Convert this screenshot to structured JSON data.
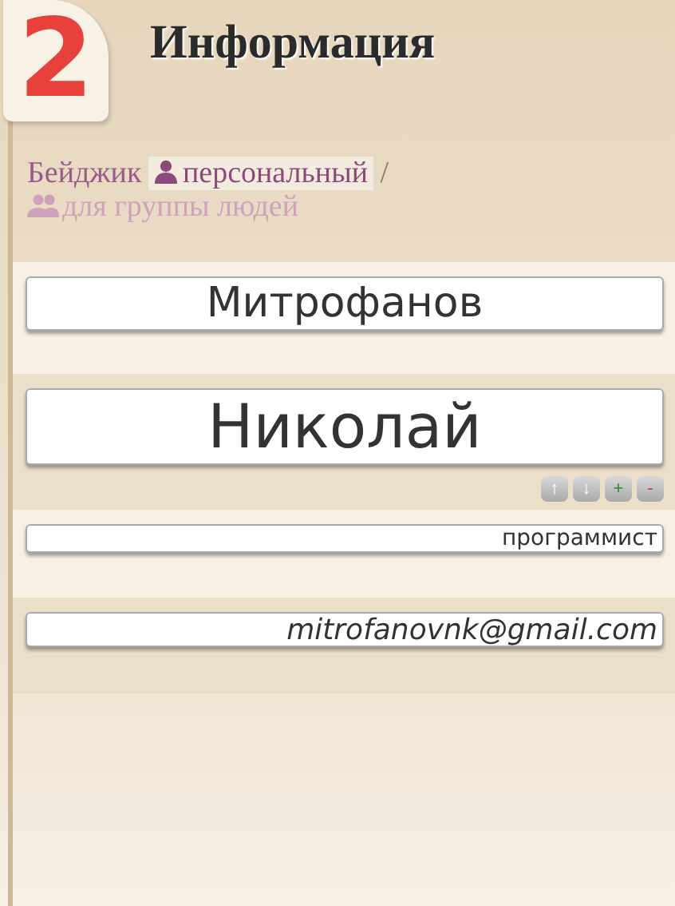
{
  "step": {
    "number": "2",
    "title": "Информация"
  },
  "badge_type": {
    "label": "Бейджик",
    "separator": "/",
    "options": [
      {
        "label": "персональный",
        "selected": true
      },
      {
        "label": "для группы людей",
        "selected": false
      }
    ]
  },
  "fields": [
    {
      "kind": "surname",
      "value": "Митрофанов"
    },
    {
      "kind": "name",
      "value": "Николай",
      "controls": [
        "↑",
        "↓",
        "+",
        "-"
      ]
    },
    {
      "kind": "position",
      "value": "программист"
    },
    {
      "kind": "email",
      "value": "mitrofanovnk@gmail.com"
    }
  ]
}
